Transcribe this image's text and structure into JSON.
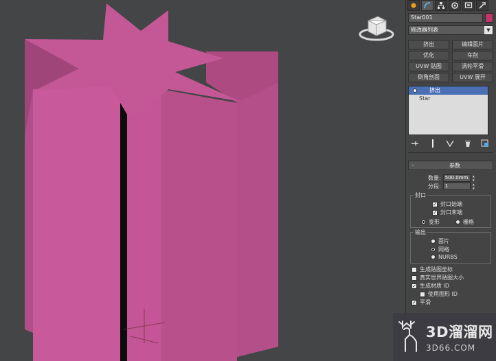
{
  "viewport": {
    "object_color": "#c1558f"
  },
  "panel": {
    "tabs": [
      {
        "icon": "sun-icon"
      },
      {
        "icon": "curve-icon"
      },
      {
        "icon": "hierarchy-icon"
      },
      {
        "icon": "motion-icon"
      },
      {
        "icon": "display-icon"
      },
      {
        "icon": "hammer-icon"
      }
    ],
    "object_name": "Star001",
    "object_color": "#c0356a",
    "modifier_list": "修改器列表",
    "buttons": [
      "挤出",
      "编辑面片",
      "优化",
      "车削",
      "UVW 贴图",
      "涡轮平滑",
      "倒角剖面",
      "UVW 展开"
    ],
    "stack": {
      "selected": "挤出",
      "base": "Star"
    },
    "params_title": "参数",
    "amount_label": "数量:",
    "amount_value": "500.0mm",
    "segments_label": "分段:",
    "segments_value": "1",
    "capping": {
      "label": "封口",
      "cap_start": "封口始端",
      "cap_end": "封口末端",
      "morph": "变形",
      "grid": "栅格"
    },
    "output": {
      "label": "输出",
      "patch": "面片",
      "mesh": "网格",
      "nurbs": "NURBS"
    },
    "gen_map_coords": "生成贴图坐标",
    "real_world": "真实世界贴图大小",
    "gen_mat_ids": "生成材质 ID",
    "use_shape_ids": "使用图形 ID",
    "smooth": "平滑"
  },
  "watermark": {
    "title": "3D溜溜网",
    "sub": "3D66.COM"
  }
}
